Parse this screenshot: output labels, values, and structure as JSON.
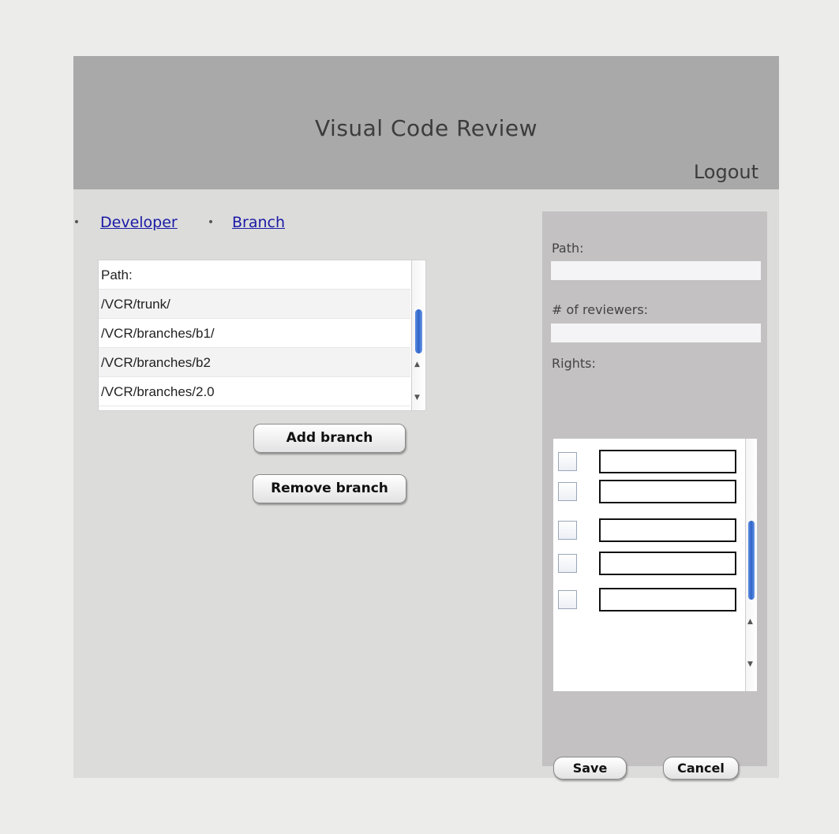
{
  "header": {
    "title": "Visual Code Review",
    "logout": "Logout"
  },
  "breadcrumb": {
    "items": [
      "Developer",
      "Branch"
    ]
  },
  "branch_list": {
    "rows": [
      "Path:",
      "/VCR/trunk/",
      "/VCR/branches/b1/",
      "/VCR/branches/b2",
      "/VCR/branches/2.0"
    ]
  },
  "buttons": {
    "add_branch": "Add branch",
    "remove_branch": "Remove branch"
  },
  "panel": {
    "path_label": "Path:",
    "path_value": "",
    "reviewers_label": "# of reviewers:",
    "reviewers_value": "",
    "rights_label": "Rights:",
    "rights_rows": 5,
    "save": "Save",
    "cancel": "Cancel"
  },
  "colors": {
    "header_bg": "#a9a9a9",
    "link": "#1a1aa6",
    "scroll_thumb": "#2f64c9"
  }
}
